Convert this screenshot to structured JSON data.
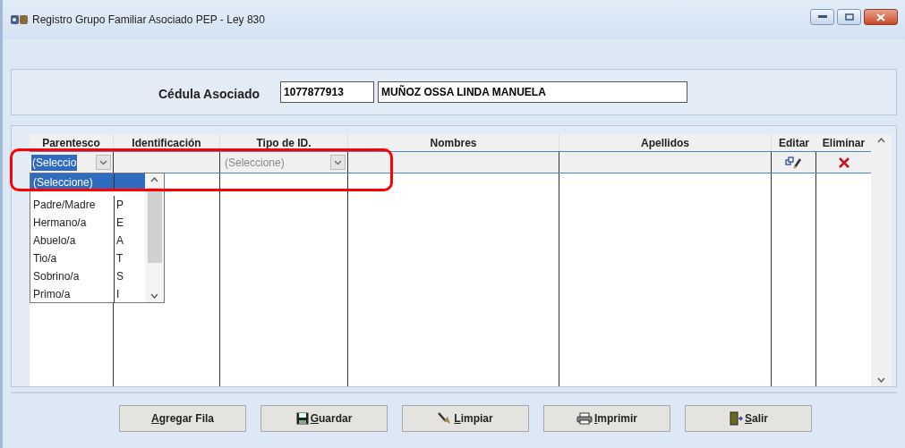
{
  "window": {
    "title": "Registro Grupo Familiar Asociado PEP - Ley 830"
  },
  "associate": {
    "label": "Cédula Asociado",
    "id_value": "1077877913",
    "name_value": "MUÑOZ OSSA LINDA MANUELA"
  },
  "table": {
    "columns": [
      "Parentesco",
      "Identificación",
      "Tipo de ID.",
      "Nombres",
      "Apellidos",
      "Editar",
      "Eliminar"
    ],
    "rows": [
      {
        "parentesco": "(Seleccio",
        "tipo_id": "(Seleccione)"
      }
    ]
  },
  "dropdown": {
    "items": [
      {
        "label": "(Seleccione)",
        "selected": true
      },
      {
        "label": "Padre/Madre",
        "code": "P",
        "selected": false
      },
      {
        "label": "Hermano/a",
        "code": "E",
        "selected": false
      },
      {
        "label": "Abuelo/a",
        "code": "A",
        "selected": false
      },
      {
        "label": "Tio/a",
        "code": "T",
        "selected": false
      },
      {
        "label": "Sobrino/a",
        "code": "S",
        "selected": false
      },
      {
        "label": "Primo/a",
        "code": "I",
        "selected": false
      }
    ]
  },
  "buttons": [
    {
      "label": "Agregar Fila",
      "kind": "add"
    },
    {
      "label": "Guardar",
      "kind": "save"
    },
    {
      "label": "Limpiar",
      "kind": "clear"
    },
    {
      "label": "Imprimir",
      "kind": "print"
    },
    {
      "label": "Salir",
      "kind": "exit"
    }
  ]
}
